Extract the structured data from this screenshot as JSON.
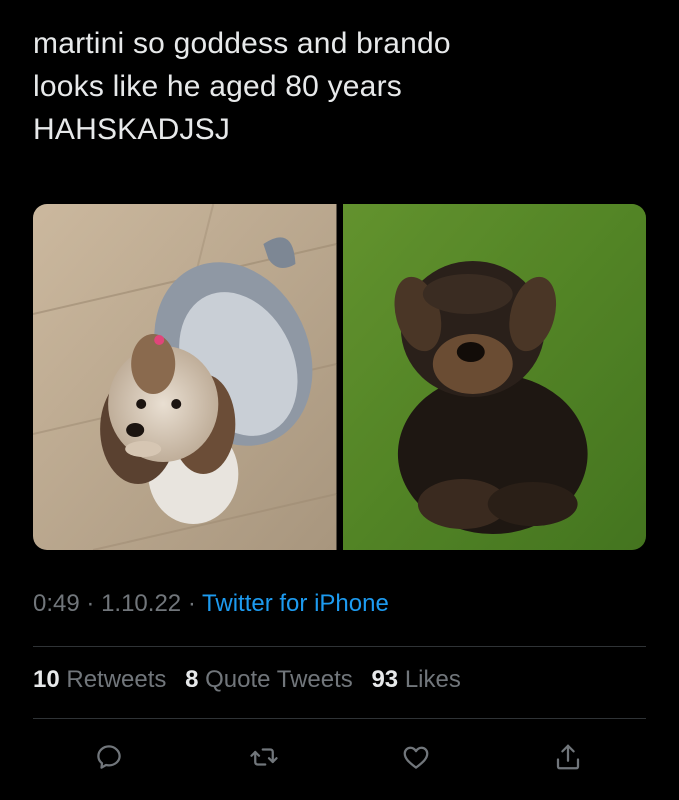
{
  "tweet": {
    "text": "martini so goddess and brando\nlooks like he aged 80 years\nHAHSKADJSJ"
  },
  "media": {
    "photos": [
      {
        "subject": "yorkshire terrier with pink hair tie on wooden floor"
      },
      {
        "subject": "dark yorkshire terrier on green grass"
      }
    ]
  },
  "meta": {
    "time": "0:49",
    "separator": "·",
    "date": "1.10.22",
    "source": "Twitter for iPhone"
  },
  "stats": {
    "retweets_count": "10",
    "retweets_label": "Retweets",
    "quotes_count": "8",
    "quotes_label": "Quote Tweets",
    "likes_count": "93",
    "likes_label": "Likes"
  },
  "actions": {
    "icons": [
      "reply-icon",
      "retweet-icon",
      "like-icon",
      "share-icon"
    ]
  },
  "colors": {
    "background": "#000000",
    "text": "#e7e9ea",
    "secondary": "#71767b",
    "link": "#1d9bf0",
    "divider": "#2f3336"
  }
}
